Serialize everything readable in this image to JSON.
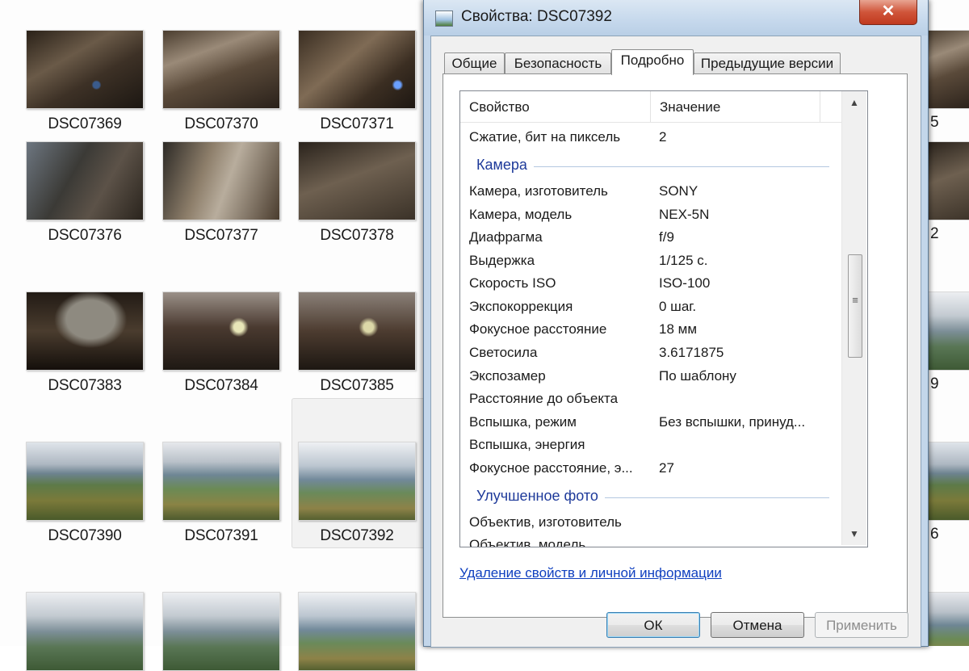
{
  "explorer": {
    "thumbs": [
      {
        "label": "DSC07369"
      },
      {
        "label": "DSC07370"
      },
      {
        "label": "DSC07371"
      },
      {
        "label": "DSC07376"
      },
      {
        "label": "DSC07377"
      },
      {
        "label": "DSC07378"
      },
      {
        "label": "DSC07383"
      },
      {
        "label": "DSC07384"
      },
      {
        "label": "DSC07385"
      },
      {
        "label": "DSC07390"
      },
      {
        "label": "DSC07391"
      },
      {
        "label": "DSC07392"
      }
    ],
    "edge_fragments": [
      "5",
      "2",
      "9",
      "6"
    ],
    "selected_item": "DSC07392"
  },
  "dialog": {
    "title": "Свойства: DSC07392",
    "close_glyph": "✕",
    "tabs": [
      {
        "label": "Общие"
      },
      {
        "label": "Безопасность"
      },
      {
        "label": "Подробно",
        "active": true
      },
      {
        "label": "Предыдущие версии"
      }
    ],
    "list": {
      "headers": {
        "property": "Свойство",
        "value": "Значение"
      },
      "rows_top": [
        {
          "property": "Сжатие, бит на пиксель",
          "value": "2"
        }
      ],
      "group_camera": "Камера",
      "camera_rows": [
        {
          "property": "Камера, изготовитель",
          "value": "SONY"
        },
        {
          "property": "Камера, модель",
          "value": "NEX-5N"
        },
        {
          "property": "Диафрагма",
          "value": "f/9"
        },
        {
          "property": "Выдержка",
          "value": "1/125 с."
        },
        {
          "property": "Скорость ISO",
          "value": "ISO-100"
        },
        {
          "property": "Экспокоррекция",
          "value": "0 шаг."
        },
        {
          "property": "Фокусное расстояние",
          "value": "18 мм"
        },
        {
          "property": "Светосила",
          "value": "3.6171875"
        },
        {
          "property": "Экспозамер",
          "value": "По шаблону"
        },
        {
          "property": "Расстояние до объекта",
          "value": ""
        },
        {
          "property": "Вспышка, режим",
          "value": "Без вспышки, принуд..."
        },
        {
          "property": "Вспышка, энергия",
          "value": ""
        },
        {
          "property": "Фокусное расстояние, э...",
          "value": "27"
        }
      ],
      "group_enhanced": "Улучшенное фото",
      "enhanced_rows": [
        {
          "property": "Объектив, изготовитель",
          "value": ""
        },
        {
          "property": "Объектив, модель",
          "value": ""
        }
      ]
    },
    "scroll": {
      "up": "▲",
      "down": "▼",
      "grip": "≡"
    },
    "remove_link": "Удаление свойств и личной информации",
    "buttons": {
      "ok": "ОК",
      "cancel": "Отмена",
      "apply": "Применить"
    }
  }
}
